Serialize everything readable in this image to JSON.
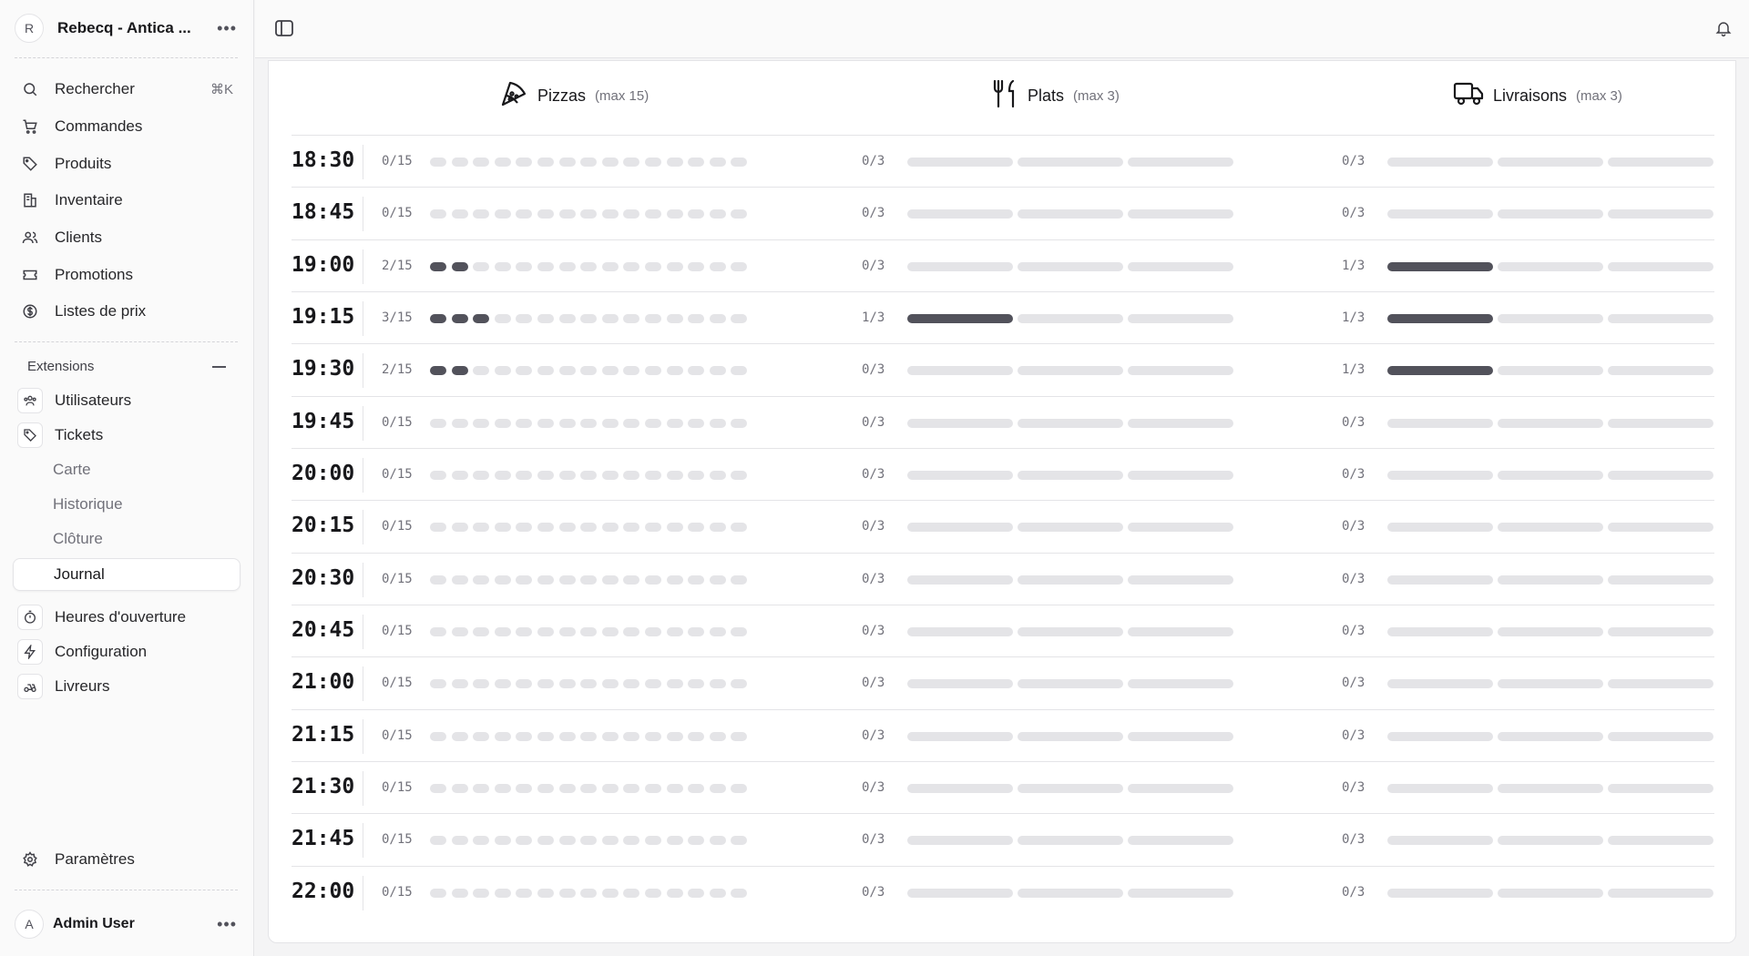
{
  "sidebar": {
    "store_initial": "R",
    "store_name": "Rebecq - Antica ...",
    "search_label": "Rechercher",
    "search_shortcut": "⌘K",
    "nav": [
      "Commandes",
      "Produits",
      "Inventaire",
      "Clients",
      "Promotions",
      "Listes de prix"
    ],
    "extensions_title": "Extensions",
    "extensions": [
      "Utilisateurs",
      "Tickets"
    ],
    "tickets_sub": [
      "Carte",
      "Historique",
      "Clôture",
      "Journal"
    ],
    "extensions2": [
      "Heures d'ouverture",
      "Configuration",
      "Livreurs"
    ],
    "settings_label": "Paramètres",
    "user_initial": "A",
    "user_name": "Admin User"
  },
  "columns": [
    {
      "title": "Pizzas",
      "max_label": "(max 15)",
      "max": 15,
      "icon": "pizza-icon"
    },
    {
      "title": "Plats",
      "max_label": "(max 3)",
      "max": 3,
      "icon": "utensils-icon"
    },
    {
      "title": "Livraisons",
      "max_label": "(max 3)",
      "max": 3,
      "icon": "truck-icon"
    }
  ],
  "slots": [
    {
      "time": "18:30",
      "counts": [
        0,
        0,
        0
      ]
    },
    {
      "time": "18:45",
      "counts": [
        0,
        0,
        0
      ]
    },
    {
      "time": "19:00",
      "counts": [
        2,
        0,
        1
      ]
    },
    {
      "time": "19:15",
      "counts": [
        3,
        1,
        1
      ]
    },
    {
      "time": "19:30",
      "counts": [
        2,
        0,
        1
      ]
    },
    {
      "time": "19:45",
      "counts": [
        0,
        0,
        0
      ]
    },
    {
      "time": "20:00",
      "counts": [
        0,
        0,
        0
      ]
    },
    {
      "time": "20:15",
      "counts": [
        0,
        0,
        0
      ]
    },
    {
      "time": "20:30",
      "counts": [
        0,
        0,
        0
      ]
    },
    {
      "time": "20:45",
      "counts": [
        0,
        0,
        0
      ]
    },
    {
      "time": "21:00",
      "counts": [
        0,
        0,
        0
      ]
    },
    {
      "time": "21:15",
      "counts": [
        0,
        0,
        0
      ]
    },
    {
      "time": "21:30",
      "counts": [
        0,
        0,
        0
      ]
    },
    {
      "time": "21:45",
      "counts": [
        0,
        0,
        0
      ]
    },
    {
      "time": "22:00",
      "counts": [
        0,
        0,
        0
      ]
    }
  ],
  "colors": {
    "filled": "#52525b",
    "empty": "#e4e4e7"
  }
}
